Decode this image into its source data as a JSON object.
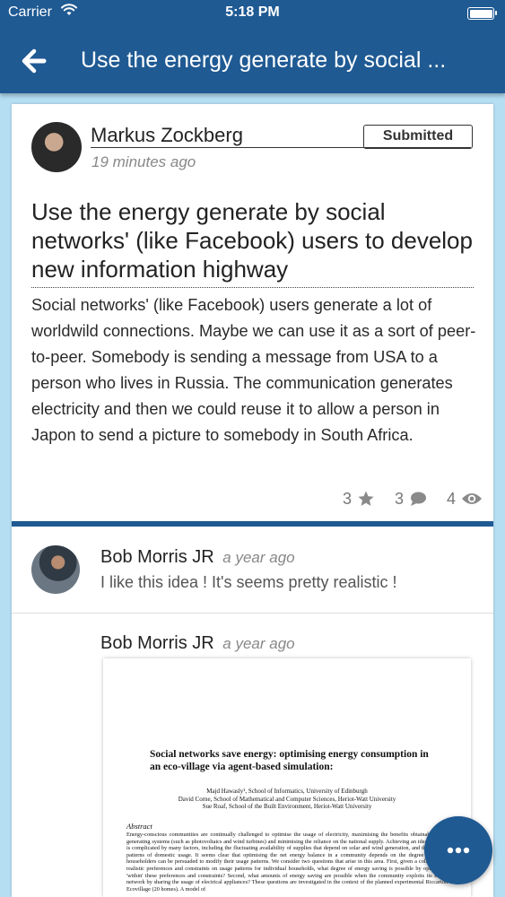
{
  "status_bar": {
    "carrier": "Carrier",
    "time": "5:18 PM"
  },
  "nav": {
    "title": "Use the energy generate by social ..."
  },
  "post": {
    "author": "Markus Zockberg",
    "status": "Submitted",
    "time_ago": "19 minutes ago",
    "title": "Use the energy generate by social networks' (like Facebook) users to develop new information highway",
    "body": "Social networks' (like Facebook) users generate a lot of worldwild connections. Maybe we can use it as a sort of peer-to-peer. Somebody is sending a message from USA to a person who lives in Russia. The communication generates electricity and then we could reuse it to allow a person in Japon to send a picture to somebody in South Africa.",
    "stats": {
      "stars": "3",
      "comments": "3",
      "views": "4"
    }
  },
  "comments": [
    {
      "author": "Bob Morris JR",
      "time_ago": "a year ago",
      "text": "I like this idea ! It's seems pretty realistic !"
    },
    {
      "author": "Bob Morris JR",
      "time_ago": "a year ago",
      "attachment": {
        "title": "Social networks save energy: optimising energy consumption in an eco-village via agent-based simulation:",
        "authors": [
          "Majd Hawasly¹, School of Informatics, University of Edinburgh",
          "David Corne, School of Mathematical and Computer Sciences, Heriot-Watt University",
          "Sue Roaf, School of the Built Environment, Heriot-Watt University"
        ],
        "abstract_heading": "Abstract",
        "abstract": "Energy-conscious communities are continually challenged to optimise the usage of electricity, maximising the benefits obtainable from generating systems (such as photovoltaics and wind turbines) and minimising the reliance on the national supply. Achieving an ideal balance is complicated by many factors, including the fluctuating availability of supplies that depend on solar and wind generation, and the varying patterns of domestic usage. It seems clear that optimising the net energy balance in a community depends on the degree to which householders can be persuaded to modify their usage patterns. We consider two questions that arise in this area. First, given a collection of realistic preferences and constraints on usage patterns for individual households, what degree of energy saving is possible by optimising 'within' these preferences and constraints? Second, what amounts of energy saving are possible when the community exploits its social network by sharing the usage of electrical appliances? These questions are investigated in the context of the planned experimental Riccarton Ecovillage (20 homes). A model of"
      }
    }
  ],
  "icons": {
    "back": "arrow-left-icon",
    "wifi": "wifi-icon",
    "battery": "battery-icon",
    "star": "star-icon",
    "comment": "comment-icon",
    "eye": "eye-icon",
    "fab": "more-dots-icon"
  },
  "colors": {
    "primary": "#1f5a93",
    "background": "#b5def3",
    "muted": "#777777"
  }
}
